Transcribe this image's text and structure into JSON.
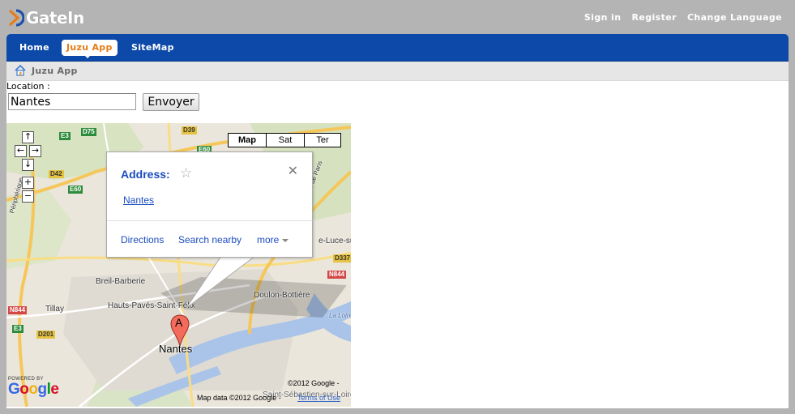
{
  "brand": {
    "name": "GateIn"
  },
  "top_links": [
    "Sign in",
    "Register",
    "Change Language"
  ],
  "nav": {
    "items": [
      "Home",
      "Juzu App",
      "SiteMap"
    ],
    "active": "Juzu App"
  },
  "breadcrumb": {
    "label": "Juzu App"
  },
  "form": {
    "location_label": "Location :",
    "location_value": "Nantes",
    "submit_label": "Envoyer"
  },
  "map": {
    "controls": {
      "up": "↑",
      "left": "←",
      "right": "→",
      "down": "↓",
      "zoom_in": "+",
      "zoom_out": "−"
    },
    "types": [
      "Map",
      "Sat",
      "Ter"
    ],
    "active_type": "Map",
    "bubble": {
      "title": "Address:",
      "place": "Nantes",
      "links": [
        "Directions",
        "Search nearby",
        "more"
      ]
    },
    "marker_letter": "A",
    "labels": {
      "city": "Nantes",
      "breil": "Breil-Barberie",
      "doulon": "Doulon-Bottière",
      "hauts": "Hauts-Pavés-Saint-Félix",
      "tillay": "Tillay",
      "peripherique": "Périphérique",
      "route_paris": "Route de Paris",
      "luce": "e-Luce-sur",
      "sebastien": "Saint-Sébastien-sur-Loire",
      "loire": "La Loire"
    },
    "roads": [
      "D75",
      "D39",
      "E3",
      "E60",
      "D42",
      "E60",
      "N844",
      "E3",
      "D201",
      "D337",
      "N844"
    ],
    "copyright": "©2012 Google -",
    "map_data": "Map data ©2012 Google -",
    "terms": "Terms of Use",
    "powered_by": "POWERED BY",
    "google_logo": "Google"
  },
  "colors": {
    "nav_bg": "#0d49a8",
    "active_tab_text": "#e67b15",
    "link": "#1a4cc0"
  }
}
